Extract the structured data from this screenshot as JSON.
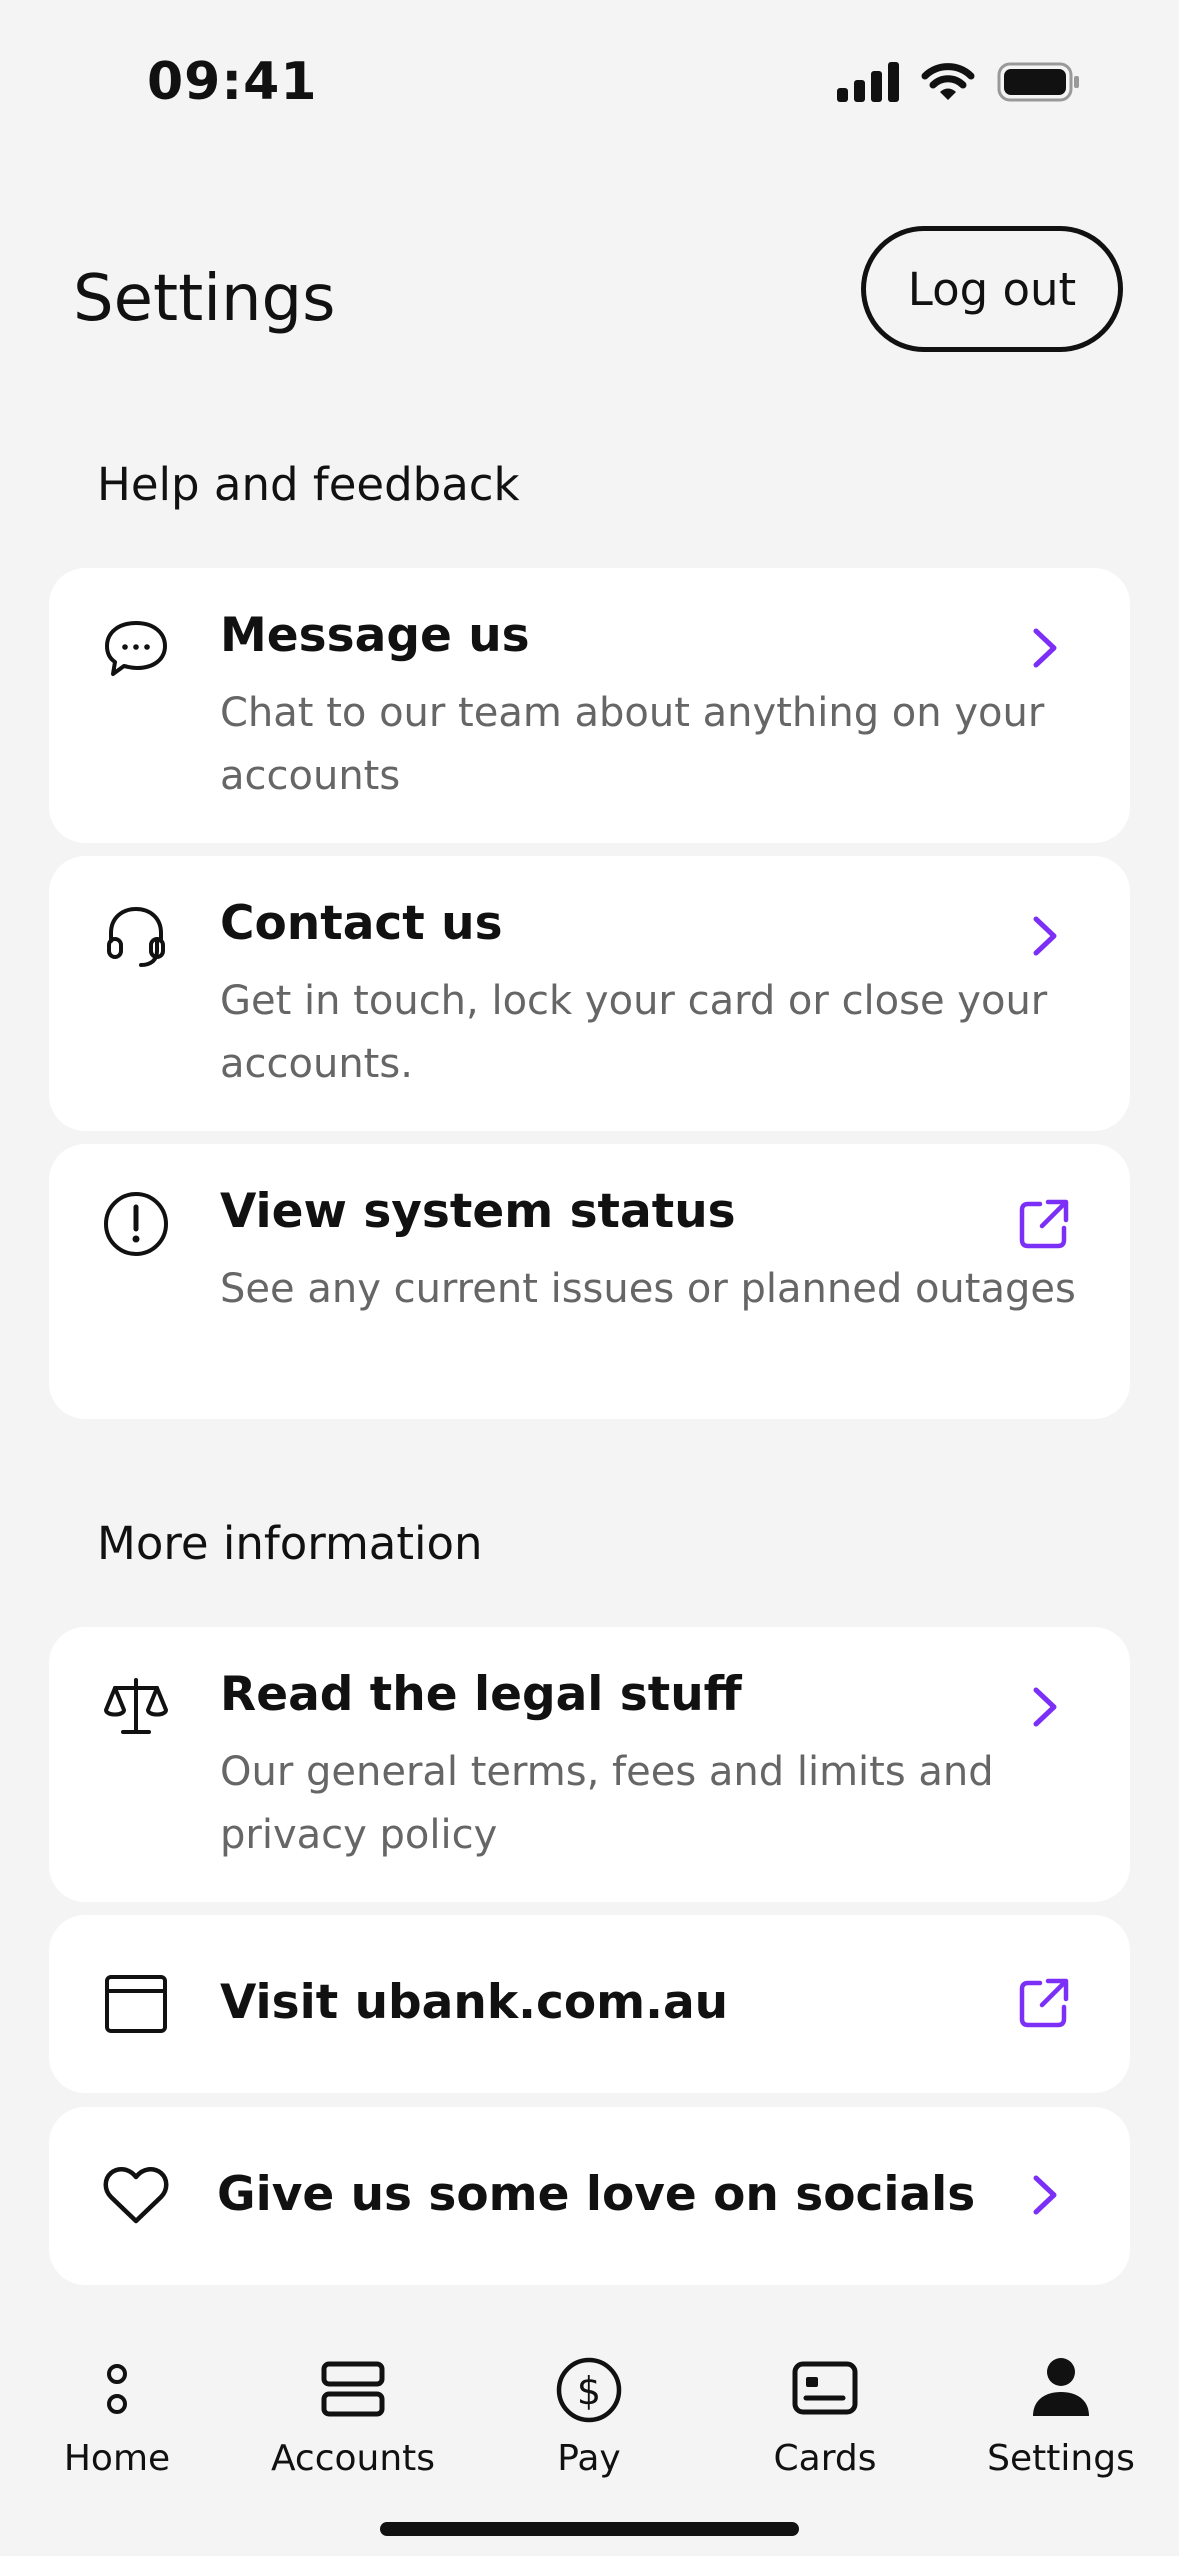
{
  "status_bar": {
    "time": "09:41"
  },
  "header": {
    "title": "Settings",
    "logout_label": "Log out"
  },
  "sections": [
    {
      "heading": "Help and feedback",
      "items": [
        {
          "icon": "chat-bubble-icon",
          "title": "Message us",
          "description": "Chat to our team about anything on your accounts",
          "action": "chevron-right-icon"
        },
        {
          "icon": "headset-icon",
          "title": "Contact us",
          "description": "Get in touch, lock your card or close your accounts.",
          "action": "chevron-right-icon"
        },
        {
          "icon": "alert-circle-icon",
          "title": "View system status",
          "description": "See any current issues or planned outages",
          "action": "external-link-icon"
        }
      ]
    },
    {
      "heading": "More information",
      "items": [
        {
          "icon": "scales-icon",
          "title": "Read the legal stuff",
          "description": "Our general terms, fees and limits and privacy policy",
          "action": "chevron-right-icon"
        },
        {
          "icon": "browser-window-icon",
          "title": "Visit ubank.com.au",
          "action": "external-link-icon"
        },
        {
          "icon": "heart-icon",
          "title": "Give us some love on socials",
          "action": "chevron-right-icon"
        }
      ]
    }
  ],
  "tabs": [
    {
      "label": "Home",
      "icon": "home-dots-icon"
    },
    {
      "label": "Accounts",
      "icon": "accounts-stack-icon"
    },
    {
      "label": "Pay",
      "icon": "dollar-circle-icon"
    },
    {
      "label": "Cards",
      "icon": "card-icon"
    },
    {
      "label": "Settings",
      "icon": "person-icon",
      "active": true
    }
  ],
  "colors": {
    "accent": "#7B2FF7",
    "background": "#F4F4F4",
    "card": "#FFFFFF",
    "text": "#111111",
    "subtext": "#666666"
  }
}
